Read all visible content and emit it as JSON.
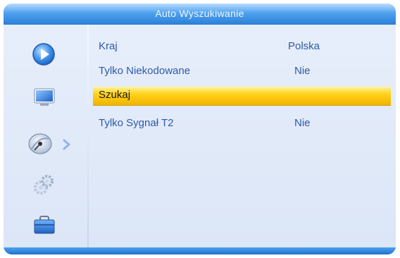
{
  "header": {
    "title": "Auto Wyszukiwanie"
  },
  "sidebar": {
    "items": [
      {
        "name": "play",
        "icon": "play-circle-icon"
      },
      {
        "name": "tv",
        "icon": "monitor-icon"
      },
      {
        "name": "satellite",
        "icon": "satellite-dish-icon",
        "active": true
      },
      {
        "name": "settings",
        "icon": "gear-icon"
      },
      {
        "name": "tools",
        "icon": "toolbox-icon"
      }
    ]
  },
  "menu": {
    "rows": [
      {
        "label": "Kraj",
        "value": "Polska"
      },
      {
        "label": "Tylko Niekodowane",
        "value": "Nie"
      },
      {
        "label": "Szukaj",
        "value": ""
      },
      {
        "label": "Tylko Sygnał T2",
        "value": "Nie"
      }
    ]
  },
  "colors": {
    "accent": "#3b8ee6",
    "highlight": "#ffd21a",
    "text": "#2d5aa8"
  }
}
